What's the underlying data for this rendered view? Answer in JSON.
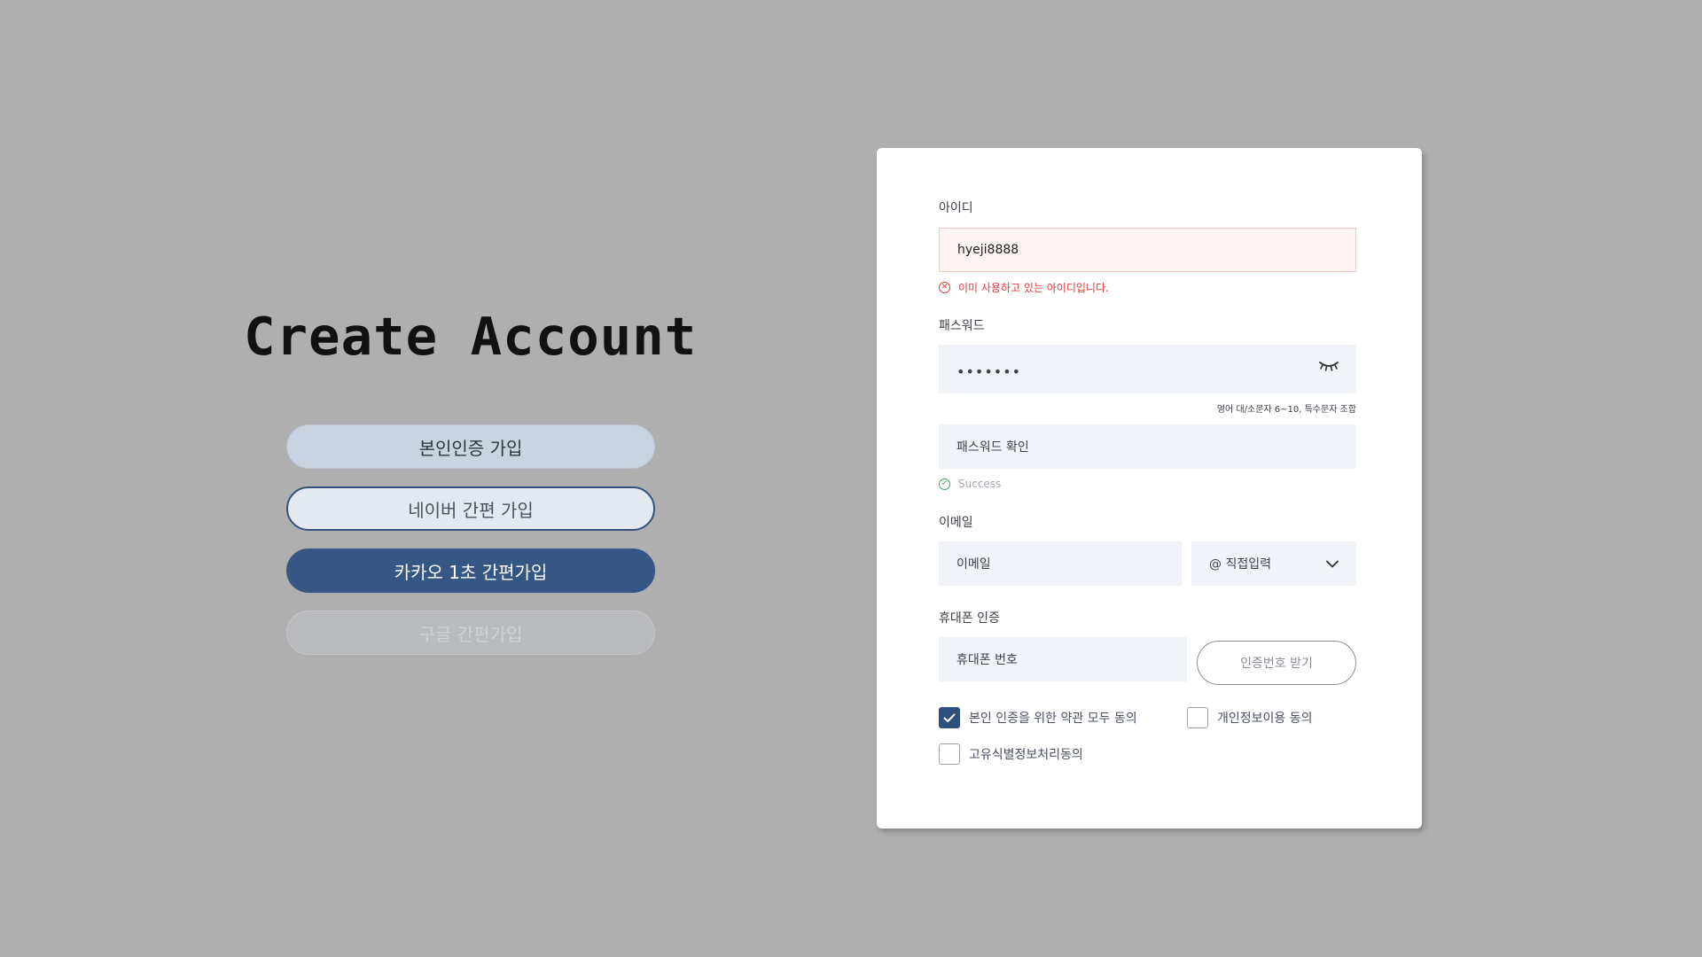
{
  "page_title": "Create Account",
  "signup_options": {
    "identity": "본인인증 가입",
    "naver": "네이버 간편 가입",
    "kakao": "카카오 1초 간편가입",
    "google": "구글 간편가입"
  },
  "form": {
    "id": {
      "label": "아이디",
      "value": "hyeji8888",
      "error": "이미 사용하고 있는 아이디입니다."
    },
    "password": {
      "label": "패스워드",
      "value": "•••••••",
      "hint": "영어 대/소문자 6~10, 특수문자  조합"
    },
    "password_confirm": {
      "placeholder": "패스워드 확인",
      "status": "Success"
    },
    "email": {
      "label": "이메일",
      "placeholder": "이메일",
      "domain_selected": "@ 직접입력"
    },
    "phone": {
      "label": "휴대폰 인증",
      "placeholder": "휴대폰 번호",
      "verify_button": "인증번호 받기"
    },
    "agreements": [
      {
        "label": "본인 인증을 위한 약관 모두 동의",
        "checked": true
      },
      {
        "label": "개인정보이용 동의",
        "checked": false
      },
      {
        "label": "고유식별정보처리동의",
        "checked": false
      }
    ]
  },
  "colors": {
    "background": "#afafaf",
    "accent": "#365783",
    "error": "#e23a3a",
    "success": "#3aa862"
  }
}
